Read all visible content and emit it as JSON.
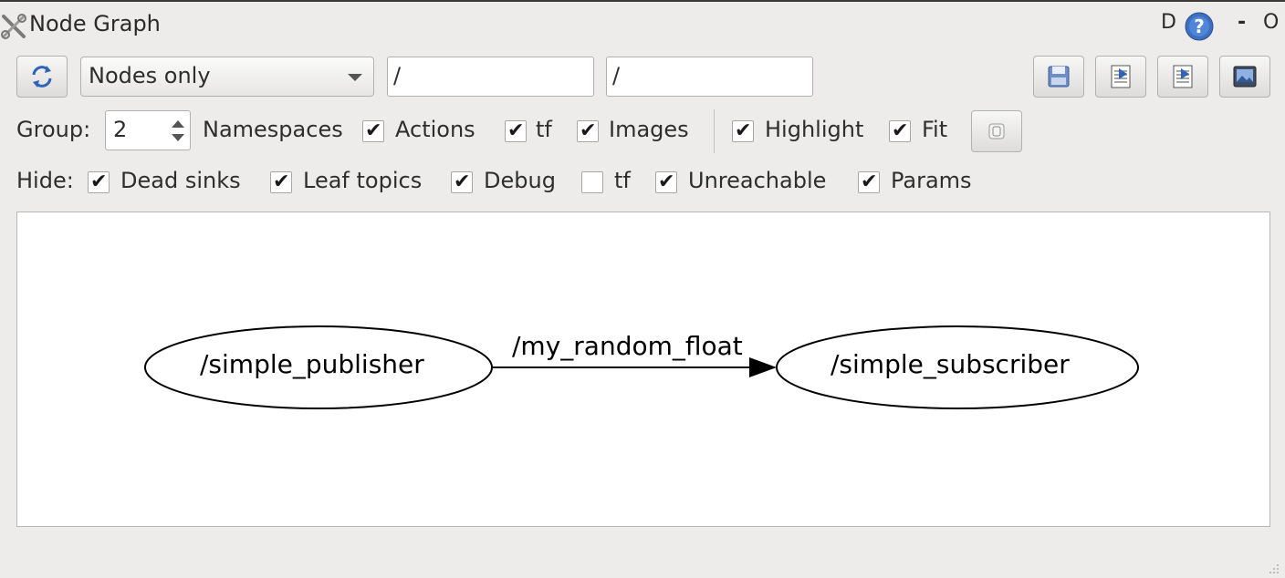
{
  "window": {
    "title": "Node Graph",
    "title_icon": "tools-icon",
    "right_d": "D",
    "help_icon": "help-icon",
    "dash": "-",
    "zero": "O"
  },
  "toolbar": {
    "refresh_icon": "refresh-icon",
    "mode_value": "Nodes only",
    "filter1_value": "/",
    "filter2_value": "/",
    "load_icon": "load-icon",
    "save_dot_icon": "save-dot-icon",
    "save_svg_icon": "save-svg-icon",
    "save_image_icon": "save-image-icon"
  },
  "options": {
    "group_label": "Group:",
    "group_value": "2",
    "namespaces_label": "Namespaces",
    "namespaces_checked": true,
    "actions_label": "Actions",
    "actions_checked": true,
    "tf_label": "tf",
    "tf_checked": true,
    "images_label": "Images",
    "highlight_checked": true,
    "highlight_label": "Highlight",
    "fit_checked": true,
    "fit_label": "Fit",
    "fit_button_icon": "fit-view-icon"
  },
  "hide": {
    "label": "Hide:",
    "items": [
      {
        "label": "Dead sinks",
        "checked": true
      },
      {
        "label": "Leaf topics",
        "checked": true
      },
      {
        "label": "Debug",
        "checked": true
      },
      {
        "label": "tf",
        "checked": false
      },
      {
        "label": "Unreachable",
        "checked": true
      },
      {
        "label": "Params",
        "checked": true
      }
    ]
  },
  "graph": {
    "nodes": [
      {
        "label": "/simple_publisher"
      },
      {
        "label": "/simple_subscriber"
      }
    ],
    "edge": {
      "label": "/my_random_float",
      "from": "/simple_publisher",
      "to": "/simple_subscriber"
    }
  },
  "checkmark": "✔"
}
